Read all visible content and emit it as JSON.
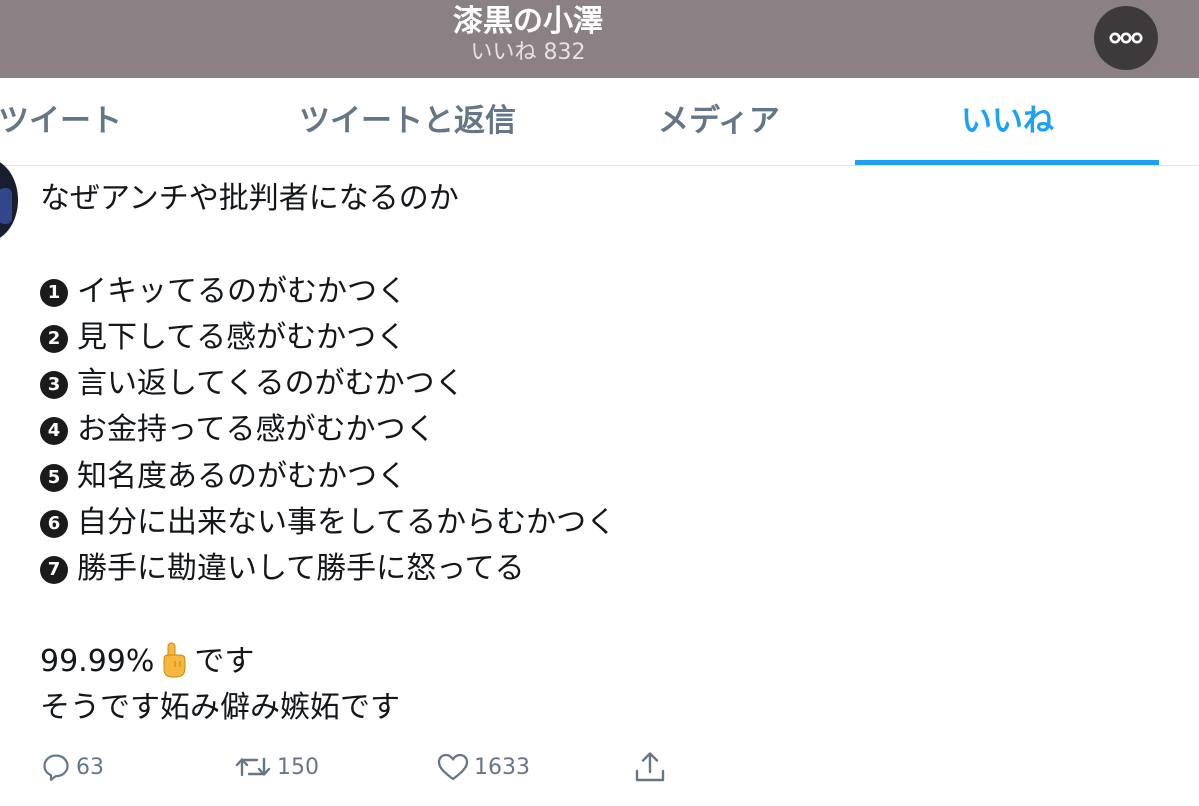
{
  "header": {
    "title": "漆黒の小澤",
    "subtitle": "いいね 832",
    "more_icon": "more-horizontal-icon"
  },
  "tabs": [
    {
      "label": "ツイート"
    },
    {
      "label": "ツイートと返信"
    },
    {
      "label": "メディア"
    },
    {
      "label": "いいね",
      "active": true
    }
  ],
  "tweet": {
    "lines": [
      "なぜアンチや批判者になるのか",
      "",
      "イキッてるのがむかつく",
      "見下してる感がむかつく",
      "言い返してくるのがむかつく",
      "お金持ってる感がむかつく",
      "知名度あるのがむかつく",
      "自分に出来ない事をしてるからむかつく",
      "勝手に勘違いして勝手に怒ってる",
      "",
      "",
      "そうです妬み僻み嫉妬です"
    ],
    "list_numbers": [
      "1",
      "2",
      "3",
      "4",
      "5",
      "6",
      "7"
    ],
    "percent_text": "99.99%",
    "percent_suffix": "です"
  },
  "actions": {
    "reply_count": "63",
    "retweet_count": "150",
    "like_count": "1633",
    "icons": [
      "reply-icon",
      "retweet-icon",
      "like-icon",
      "share-icon"
    ]
  },
  "colors": {
    "header_bg": "#8b8084",
    "accent": "#1da1f2",
    "muted": "#657786"
  }
}
